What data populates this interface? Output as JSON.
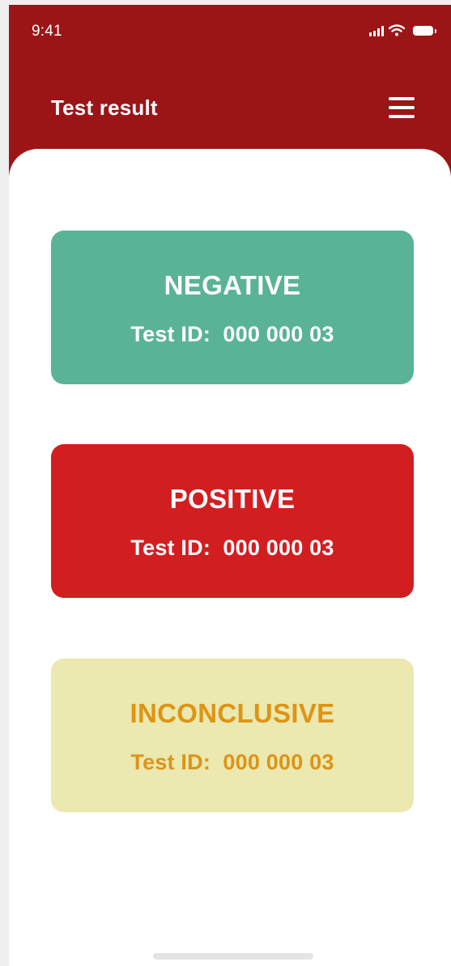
{
  "status_bar": {
    "time": "9:41",
    "icons": [
      "cellular-signal-icon",
      "wifi-icon",
      "battery-icon"
    ]
  },
  "header": {
    "title": "Test result",
    "menu_icon": "hamburger-menu-icon",
    "background_color": "#9b1517"
  },
  "results": [
    {
      "label": "NEGATIVE",
      "id_text": "Test ID:  000 000 03",
      "background_color": "#5ab396",
      "text_color": "#ffffff"
    },
    {
      "label": "POSITIVE",
      "id_text": "Test ID:  000 000 03",
      "background_color": "#d21e20",
      "text_color": "#ffffff"
    },
    {
      "label": "INCONCLUSIVE",
      "id_text": "Test ID:  000 000 03",
      "background_color": "#ebe8b0",
      "text_color": "#de9413"
    }
  ]
}
